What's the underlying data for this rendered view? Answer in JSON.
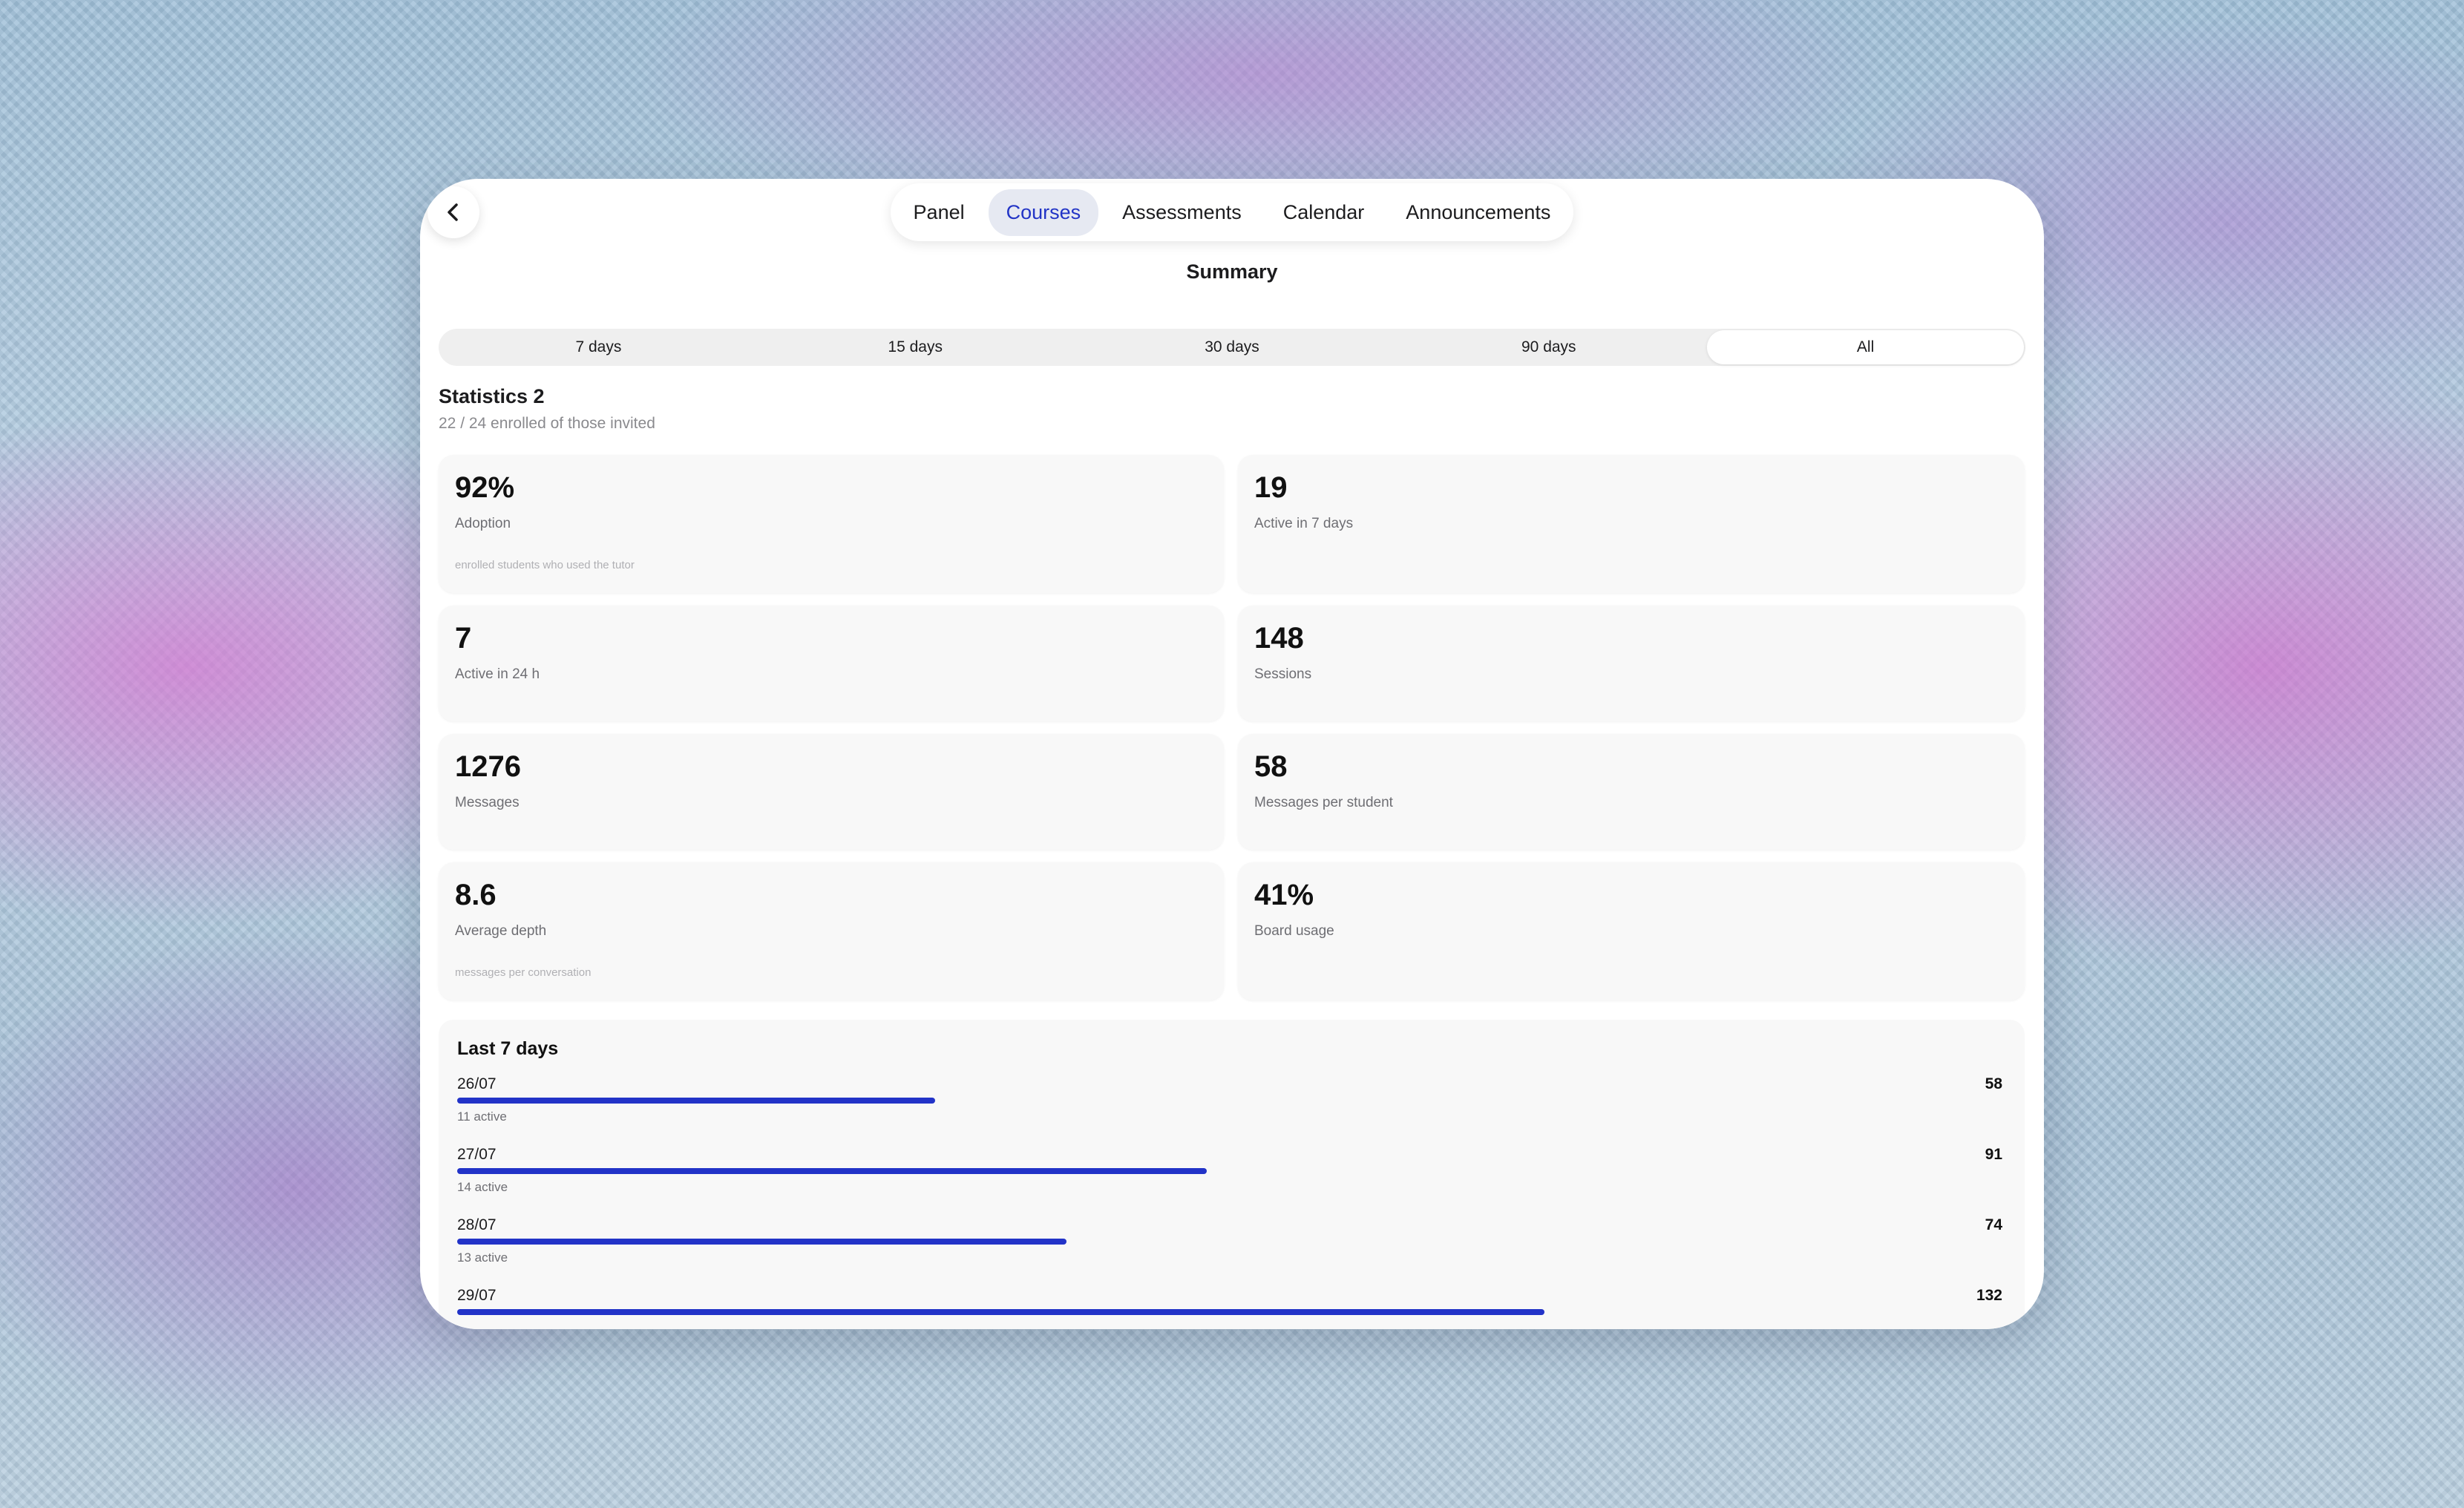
{
  "colors": {
    "accent": "#2234c6",
    "bar": "#2233c8",
    "window_bg": "#ffffff",
    "card_bg": "#f8f8f8"
  },
  "nav": {
    "back_icon": "chevron-left-icon",
    "tabs": [
      {
        "label": "Panel",
        "active": false
      },
      {
        "label": "Courses",
        "active": true
      },
      {
        "label": "Assessments",
        "active": false
      },
      {
        "label": "Calendar",
        "active": false
      },
      {
        "label": "Announcements",
        "active": false
      }
    ]
  },
  "page": {
    "title": "Summary"
  },
  "range": {
    "options": [
      "7 days",
      "15 days",
      "30 days",
      "90 days",
      "All"
    ],
    "selected": "All"
  },
  "stats": {
    "title": "Statistics 2",
    "subtitle": "22 / 24 enrolled of those invited",
    "cards": [
      {
        "value": "92%",
        "label": "Adoption",
        "note": "enrolled students who used the tutor"
      },
      {
        "value": "19",
        "label": "Active in 7 days",
        "note": ""
      },
      {
        "value": "7",
        "label": "Active in 24 h",
        "note": ""
      },
      {
        "value": "148",
        "label": "Sessions",
        "note": ""
      },
      {
        "value": "1276",
        "label": "Messages",
        "note": ""
      },
      {
        "value": "58",
        "label": "Messages per student",
        "note": ""
      },
      {
        "value": "8.6",
        "label": "Average depth",
        "note": "messages per conversation"
      },
      {
        "value": "41%",
        "label": "Board usage",
        "note": ""
      }
    ]
  },
  "last7": {
    "title": "Last 7 days",
    "days": [
      {
        "date": "26/07",
        "count": 58,
        "active": "11 active"
      },
      {
        "date": "27/07",
        "count": 91,
        "active": "14 active"
      },
      {
        "date": "28/07",
        "count": 74,
        "active": "13 active"
      },
      {
        "date": "29/07",
        "count": 132,
        "active": ""
      }
    ]
  }
}
